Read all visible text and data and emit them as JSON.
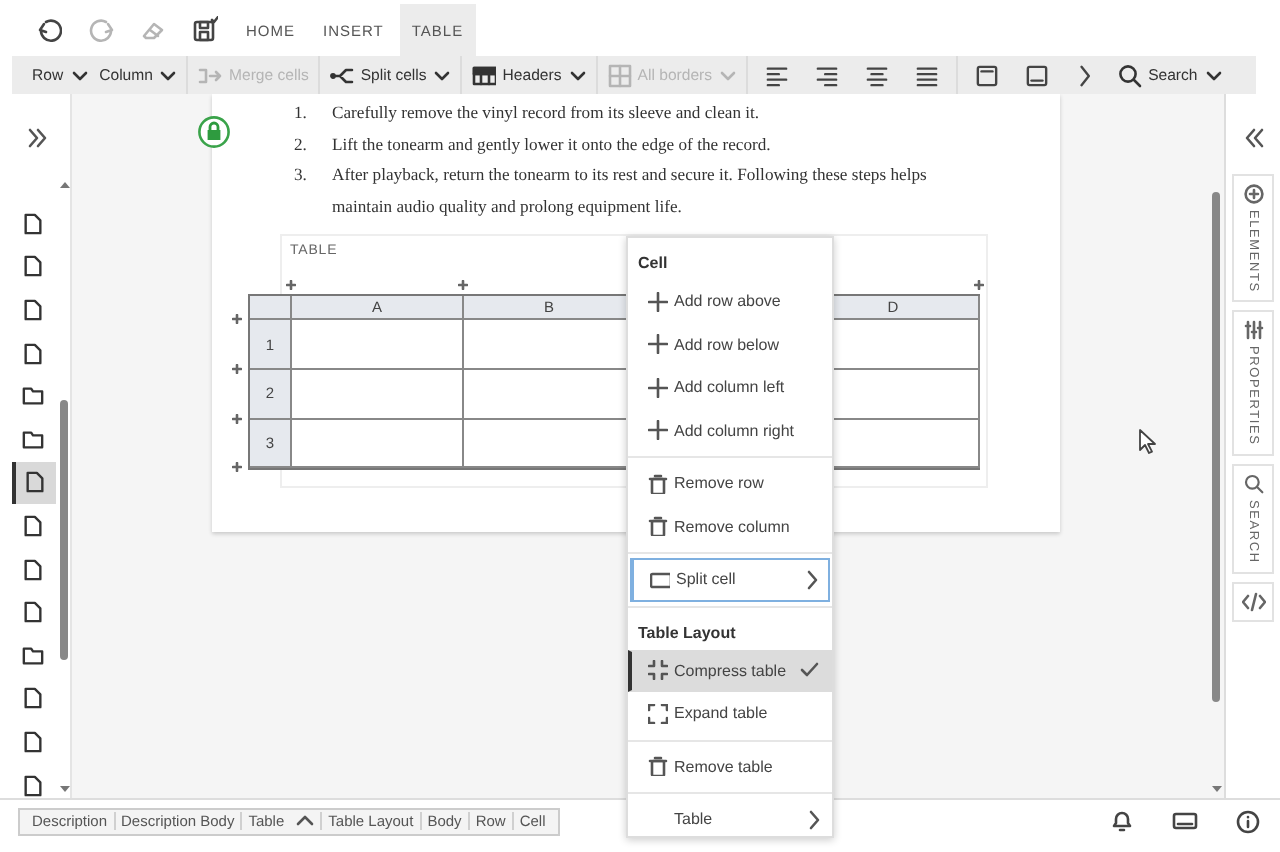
{
  "topbar": {
    "actions": [
      {
        "kind": "undo",
        "disabled": false
      },
      {
        "kind": "redo",
        "disabled": true
      },
      {
        "kind": "eraser",
        "disabled": true
      },
      {
        "kind": "save",
        "disabled": false
      }
    ],
    "tabs": [
      {
        "label": "HOME",
        "selected": false
      },
      {
        "label": "INSERT",
        "selected": false
      },
      {
        "label": "TABLE",
        "selected": true
      }
    ]
  },
  "toolbar": {
    "groups": [
      [
        {
          "kind": "text",
          "label": "Row",
          "disabled": false,
          "menu": true
        },
        {
          "kind": "text",
          "label": "Column",
          "disabled": false,
          "menu": true
        }
      ],
      [
        {
          "kind": "merge",
          "label": "Merge cells",
          "disabled": true,
          "menu": false
        }
      ],
      [
        {
          "kind": "split",
          "label": "Split cells",
          "disabled": false,
          "menu": true
        }
      ],
      [
        {
          "kind": "headers",
          "label": "Headers",
          "disabled": false,
          "menu": true
        }
      ],
      [
        {
          "kind": "borders",
          "label": "All borders",
          "disabled": true,
          "menu": true
        }
      ],
      [
        {
          "kind": "align-left",
          "disabled": false
        },
        {
          "kind": "align-right",
          "disabled": false
        },
        {
          "kind": "align-center",
          "disabled": false
        },
        {
          "kind": "justify",
          "disabled": false
        }
      ],
      [
        {
          "kind": "header-row",
          "disabled": false
        },
        {
          "kind": "footer-row",
          "disabled": false
        },
        {
          "kind": "more",
          "disabled": false
        },
        {
          "kind": "search",
          "label": "Search",
          "disabled": false,
          "menu": true
        }
      ]
    ]
  },
  "sidebar": {
    "items": [
      {
        "kind": "file",
        "selected": false
      },
      {
        "kind": "file",
        "selected": false
      },
      {
        "kind": "file",
        "selected": false
      },
      {
        "kind": "file",
        "selected": false
      },
      {
        "kind": "folder",
        "selected": false
      },
      {
        "kind": "folder",
        "selected": false
      },
      {
        "kind": "file",
        "selected": true
      },
      {
        "kind": "file",
        "selected": false
      },
      {
        "kind": "file",
        "selected": false
      },
      {
        "kind": "file",
        "selected": false
      },
      {
        "kind": "folder",
        "selected": false
      },
      {
        "kind": "file",
        "selected": false
      },
      {
        "kind": "file",
        "selected": false
      },
      {
        "kind": "file",
        "selected": false
      }
    ]
  },
  "document": {
    "list": [
      {
        "number": "1.",
        "text": "Carefully remove the vinyl record from its sleeve and clean it."
      },
      {
        "number": "2.",
        "text": "Lift the tonearm and gently lower it onto the edge of the record."
      },
      {
        "number": "3.",
        "text": "After playback, return the tonearm to its rest and secure it. Following these steps helps maintain audio quality and prolong equipment life."
      }
    ],
    "table": {
      "label": "TABLE",
      "columns": [
        {
          "label": "A"
        },
        {
          "label": "B"
        },
        {},
        {
          "label": "D"
        }
      ],
      "rows": [
        {
          "label": "1"
        },
        {
          "label": "2"
        },
        {
          "label": "3"
        }
      ]
    }
  },
  "context_menu": {
    "sections": [
      {
        "title": "Cell",
        "items": [
          {
            "kind": "add",
            "label": "Add row above",
            "focused": false,
            "selected": false,
            "submenu": false
          },
          {
            "kind": "add",
            "label": "Add row below",
            "focused": false,
            "selected": false,
            "submenu": false
          },
          {
            "kind": "add",
            "label": "Add column left",
            "focused": false,
            "selected": false,
            "submenu": false
          },
          {
            "kind": "add",
            "label": "Add column right",
            "focused": false,
            "selected": false,
            "submenu": false
          }
        ]
      },
      {
        "items": [
          {
            "kind": "remove",
            "label": "Remove row",
            "focused": false,
            "selected": false,
            "submenu": false
          },
          {
            "kind": "remove",
            "label": "Remove column",
            "focused": false,
            "selected": false,
            "submenu": false
          }
        ]
      },
      {
        "items": [
          {
            "kind": "split",
            "label": "Split cell",
            "focused": true,
            "selected": false,
            "submenu": true
          }
        ]
      },
      {
        "title": "Table Layout",
        "items": [
          {
            "kind": "compress",
            "label": "Compress table",
            "focused": false,
            "selected": true,
            "submenu": false
          },
          {
            "kind": "expand",
            "label": "Expand table",
            "focused": false,
            "selected": false,
            "submenu": false
          }
        ]
      },
      {
        "items": [
          {
            "kind": "remove",
            "label": "Remove table",
            "focused": false,
            "selected": false,
            "submenu": false
          }
        ]
      },
      {
        "items": [
          {
            "kind": "plain",
            "label": "Table",
            "focused": false,
            "selected": false,
            "submenu": true
          }
        ]
      }
    ]
  },
  "right_panel": {
    "tabs": [
      {
        "kind": "elements",
        "label": "ELEMENTS"
      },
      {
        "kind": "properties",
        "label": "PROPERTIES"
      },
      {
        "kind": "search",
        "label": "SEARCH"
      },
      {
        "kind": "code"
      }
    ]
  },
  "status_bar": {
    "breadcrumbs": [
      {
        "kind": "crumb",
        "label": "Description"
      },
      {
        "kind": "crumb",
        "label": "Description Body"
      },
      {
        "kind": "crumb",
        "label": "Table"
      },
      {
        "kind": "up"
      },
      {
        "kind": "crumb",
        "label": "Table Layout"
      },
      {
        "kind": "crumb",
        "label": "Body"
      },
      {
        "kind": "crumb",
        "label": "Row"
      },
      {
        "kind": "crumb",
        "label": "Cell"
      }
    ]
  }
}
